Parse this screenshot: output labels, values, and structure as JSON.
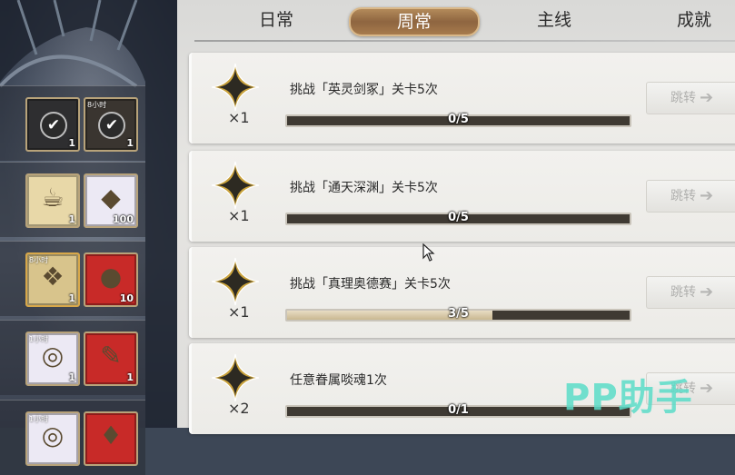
{
  "tabs": [
    {
      "label": "日常",
      "active": false
    },
    {
      "label": "周常",
      "active": true
    },
    {
      "label": "主线",
      "active": false
    },
    {
      "label": "成就",
      "active": false
    }
  ],
  "quests": [
    {
      "title": "挑战「英灵剑冢」关卡5次",
      "reward_count": "×1",
      "progress_text": "0/5",
      "progress": 0.0,
      "button": "跳转"
    },
    {
      "title": "挑战「通天深渊」关卡5次",
      "reward_count": "×1",
      "progress_text": "0/5",
      "progress": 0.0,
      "button": "跳转"
    },
    {
      "title": "挑战「真理奥德赛」关卡5次",
      "reward_count": "×1",
      "progress_text": "3/5",
      "progress": 0.6,
      "button": "跳转"
    },
    {
      "title": "任意眷属啖魂1次",
      "reward_count": "×2",
      "progress_text": "0/1",
      "progress": 0.0,
      "button": "跳转"
    }
  ],
  "reward_rows": [
    {
      "items": [
        {
          "icon": "check-badge-icon",
          "qty": "1",
          "tag": "",
          "bg": "#2e2e30"
        },
        {
          "icon": "check-badge-icon",
          "qty": "1",
          "tag": "8小时",
          "bg": "#3a3530"
        }
      ]
    },
    {
      "items": [
        {
          "icon": "teapot-icon",
          "qty": "1",
          "tag": "",
          "bg": "#e8d8a8"
        },
        {
          "icon": "ore-icon",
          "qty": "100",
          "tag": "",
          "bg": "#ece9f4"
        }
      ]
    },
    {
      "items": [
        {
          "icon": "treasure-pile-icon",
          "qty": "1",
          "tag": "8小时",
          "bg": "#d8c48c"
        },
        {
          "icon": "red-gem-icon",
          "qty": "10",
          "tag": "",
          "bg": "#c82a28"
        }
      ]
    },
    {
      "items": [
        {
          "icon": "coin-pile-icon",
          "qty": "1",
          "tag": "1小时",
          "bg": "#ece9f4"
        },
        {
          "icon": "scroll-icon",
          "qty": "1",
          "tag": "",
          "bg": "#c82a28"
        }
      ]
    },
    {
      "items": [
        {
          "icon": "coin-pile-icon",
          "qty": "",
          "tag": "1小时",
          "bg": "#ece9f4"
        },
        {
          "icon": "red-card-icon",
          "qty": "",
          "tag": "",
          "bg": "#c82a28"
        }
      ]
    }
  ],
  "watermark": "PP助手",
  "colors": {
    "accent_tab": "#9a7048",
    "progress_fill": "#d8cbaa",
    "watermark": "#5adcc8"
  }
}
